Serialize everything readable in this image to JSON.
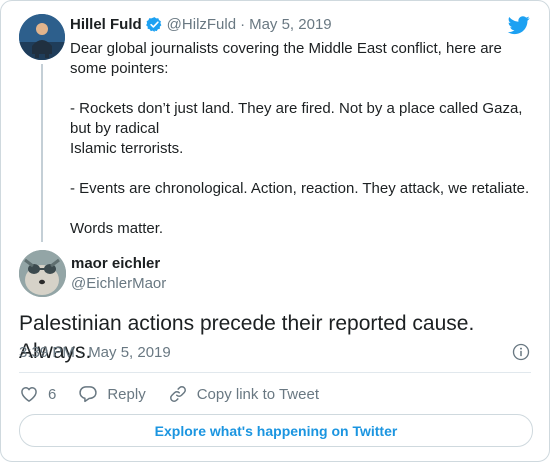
{
  "parent": {
    "name": "Hillel Fuld",
    "handle": "@HilzFuld",
    "separator": "·",
    "date": "May 5, 2019",
    "avatar_icon": "user-avatar-icon",
    "lines": [
      "Dear global journalists covering the Middle East conflict, here are some pointers:",
      "- Rockets don’t just land. They are fired. Not by a place called Gaza, but by radical",
      "Islamic terrorists.",
      "- Events are chronological. Action, reaction. They attack, we retaliate.",
      "Words matter."
    ]
  },
  "tweet": {
    "name": "maor eichler",
    "handle": "@EichlerMaor",
    "text": "Palestinian actions precede their reported cause. Always.",
    "timestamp": "3:39 PM · May 5, 2019"
  },
  "actions": {
    "like_count": "6",
    "reply_label": "Reply",
    "copy_link_label": "Copy link to Tweet"
  },
  "explore_label": "Explore what's happening on Twitter",
  "colors": {
    "accent": "#1b95e0",
    "verified": "#1da1f2",
    "muted": "#697882",
    "border": "#cfd9de"
  },
  "icons": {
    "brand": "twitter-bird-icon",
    "verified": "verified-badge-icon",
    "info": "info-icon",
    "like": "heart-icon",
    "reply": "reply-bubble-icon",
    "link": "link-icon"
  }
}
